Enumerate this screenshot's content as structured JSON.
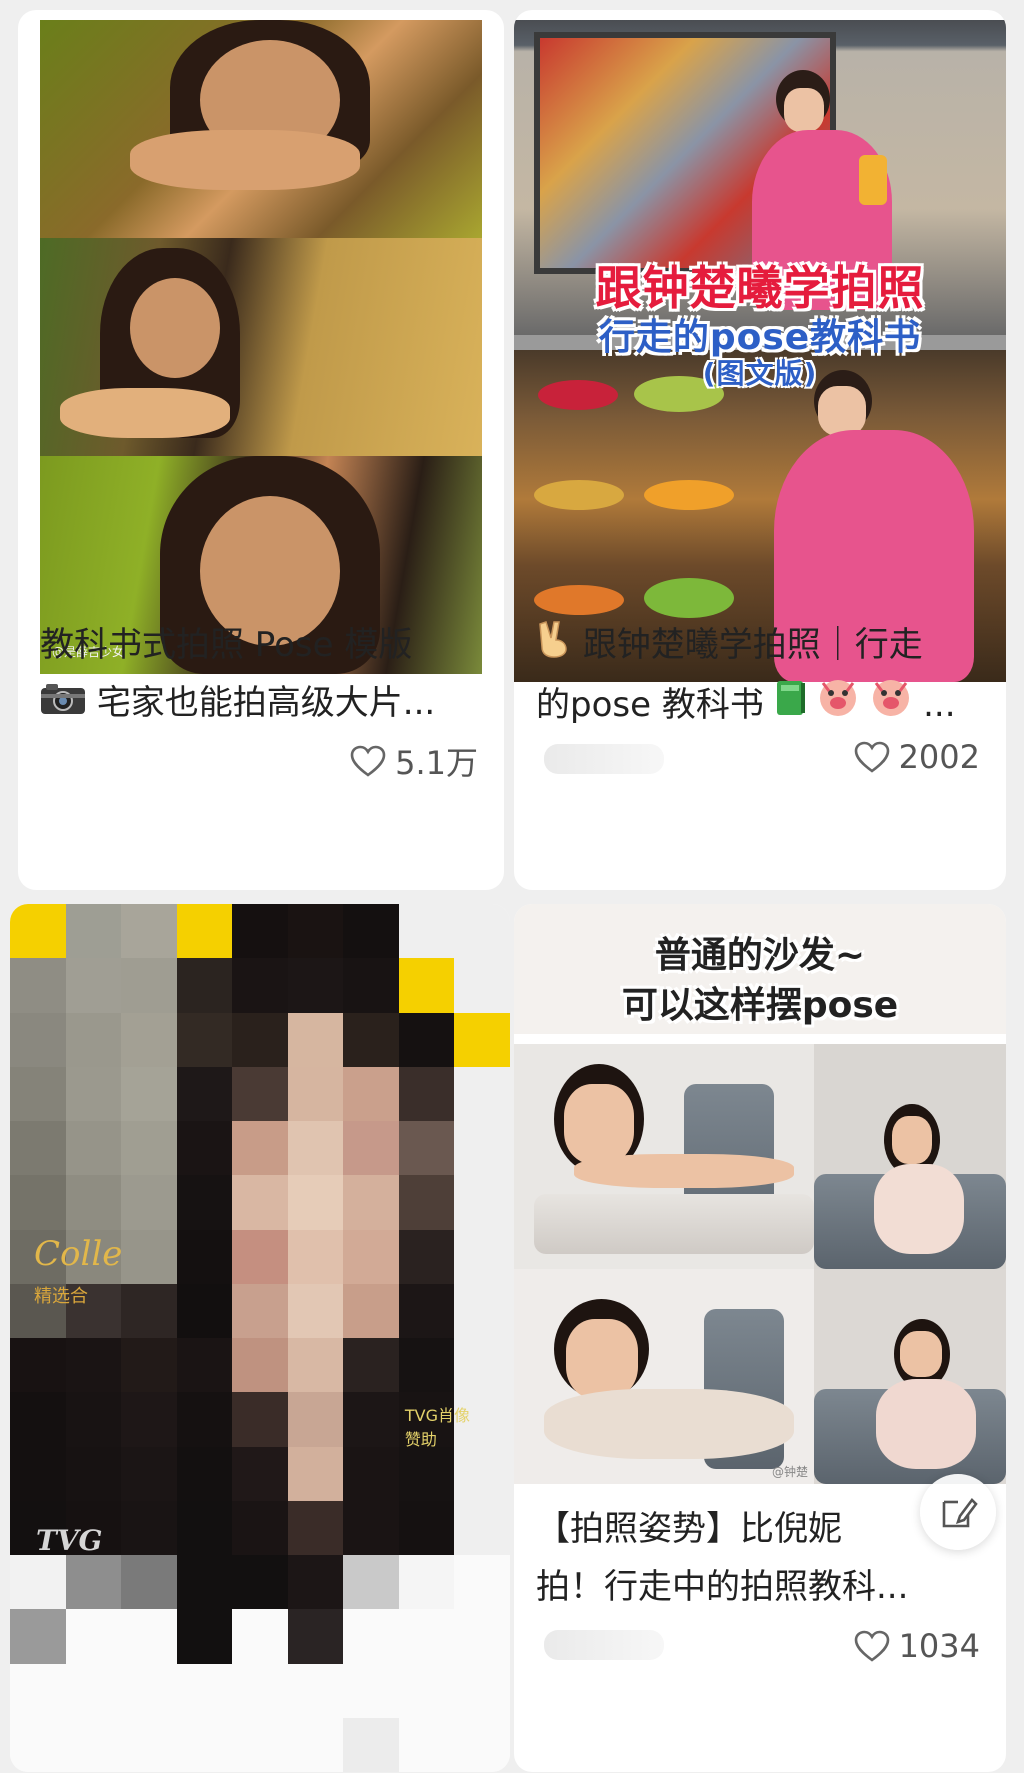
{
  "feed": {
    "cards": [
      {
        "title_line1": "教科书式拍照 Pose 模版",
        "title_line2": "宅家也能拍高级大片...",
        "likes": "5.1万",
        "image_watermark": "@是薛吉少女"
      },
      {
        "title_line1": "跟钟楚曦学拍照｜行走",
        "title_line2": "的pose 教科书",
        "title_line2_tail": "...",
        "likes": "2002",
        "overlay_title": "跟钟楚曦学拍照",
        "overlay_subtitle": "行走的pose教科书",
        "overlay_tag": "(图文版)"
      },
      {
        "overlay_script": "Colle",
        "overlay_cn": "精选合",
        "overlay_brand": "TVG肖像",
        "overlay_brand2": "赞助",
        "logo_text": "TVG"
      },
      {
        "caption_line1": "普通的沙发~",
        "caption_line2": "可以这样摆pose",
        "title_line1": "【拍照姿势】比倪妮",
        "title_line2": "拍！行走中的拍照教科...",
        "likes": "1034",
        "image_watermark": "@钟楚"
      }
    ]
  },
  "colors": {
    "accent_red": "#e51c3d",
    "accent_blue": "#2d5fc6",
    "like_gray": "#555555"
  },
  "icons": {
    "like": "heart-outline-icon",
    "edit": "edit-note-icon",
    "camera": "camera-icon",
    "victory": "victory-hand-icon",
    "book": "green-book-icon",
    "sticker": "pig-face-icon"
  }
}
